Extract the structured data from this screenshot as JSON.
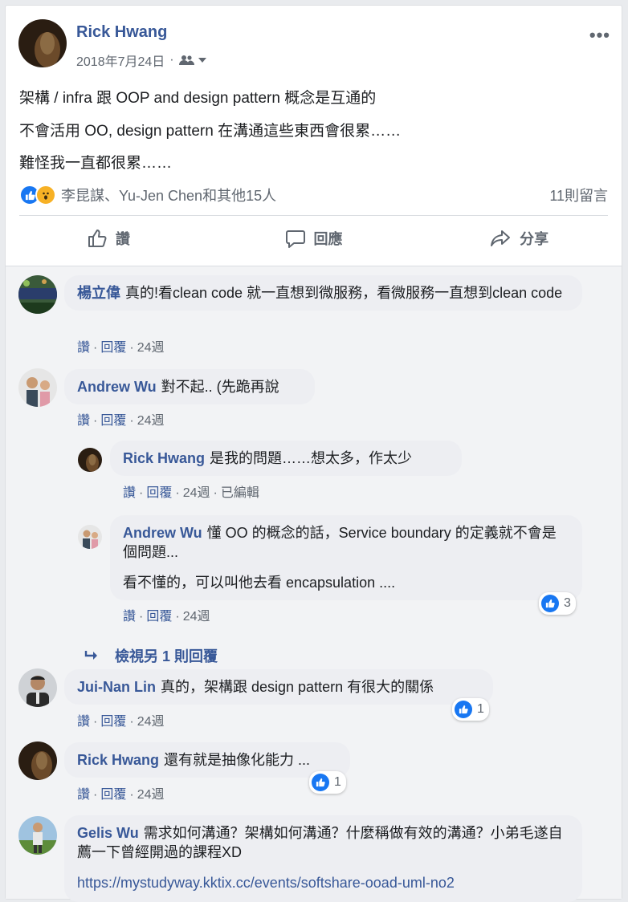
{
  "post": {
    "author": "Rick Hwang",
    "date": "2018年7月24日",
    "date_sep": "·",
    "lines": [
      "架構 / infra 跟 OOP and design pattern 概念是互通的",
      "不會活用 OO, design pattern 在溝通這些東西會很累……",
      "難怪我一直都很累……"
    ],
    "reactions_text": "李昆謀、Yu-Jen Chen和其他15人",
    "comment_count": "11則留言",
    "actions": {
      "like": "讚",
      "comment": "回應",
      "share": "分享"
    }
  },
  "comments": [
    {
      "author": "楊立偉",
      "text": "真的!看clean code 就一直想到微服務，看微服務一直想到clean code",
      "like": "讚",
      "reply": "回覆",
      "time": "24週"
    },
    {
      "author": "Andrew Wu",
      "text": "對不起.. (先跪再說",
      "like": "讚",
      "reply": "回覆",
      "time": "24週",
      "replies": [
        {
          "author": "Rick Hwang",
          "text": "是我的問題……想太多，作太少",
          "like": "讚",
          "reply": "回覆",
          "time": "24週",
          "edited": "已編輯"
        },
        {
          "author": "Andrew Wu",
          "text": "懂 OO 的概念的話，Service boundary 的定義就不會是個問題...",
          "text2": "看不懂的，可以叫他去看 encapsulation ....",
          "like": "讚",
          "reply": "回覆",
          "time": "24週",
          "reactions": "3"
        }
      ],
      "view_more": "檢視另 1 則回覆"
    },
    {
      "author": "Jui-Nan Lin",
      "text": "真的，架構跟 design pattern 有很大的關係",
      "like": "讚",
      "reply": "回覆",
      "time": "24週",
      "reactions": "1"
    },
    {
      "author": "Rick Hwang",
      "text": "還有就是抽像化能力 ...",
      "like": "讚",
      "reply": "回覆",
      "time": "24週",
      "reactions": "1"
    },
    {
      "author": "Gelis Wu",
      "text": "需求如何溝通？架構如何溝通？什麼稱做有效的溝通？小弟毛遂自薦一下曾經開過的課程XD",
      "link": "https://mystudyway.kktix.cc/events/softshare-ooad-uml-no2"
    }
  ],
  "colors": {
    "link": "#385898",
    "like_blue": "#1877f2",
    "wow_yellow": "#f7b125",
    "bubble": "#edeef2"
  },
  "icons": [
    "more-icon",
    "friends-audience-icon",
    "dropdown-caret-icon",
    "like-reaction-icon",
    "wow-reaction-icon",
    "like-outline-icon",
    "comment-outline-icon",
    "share-outline-icon",
    "reply-arrow-icon"
  ]
}
